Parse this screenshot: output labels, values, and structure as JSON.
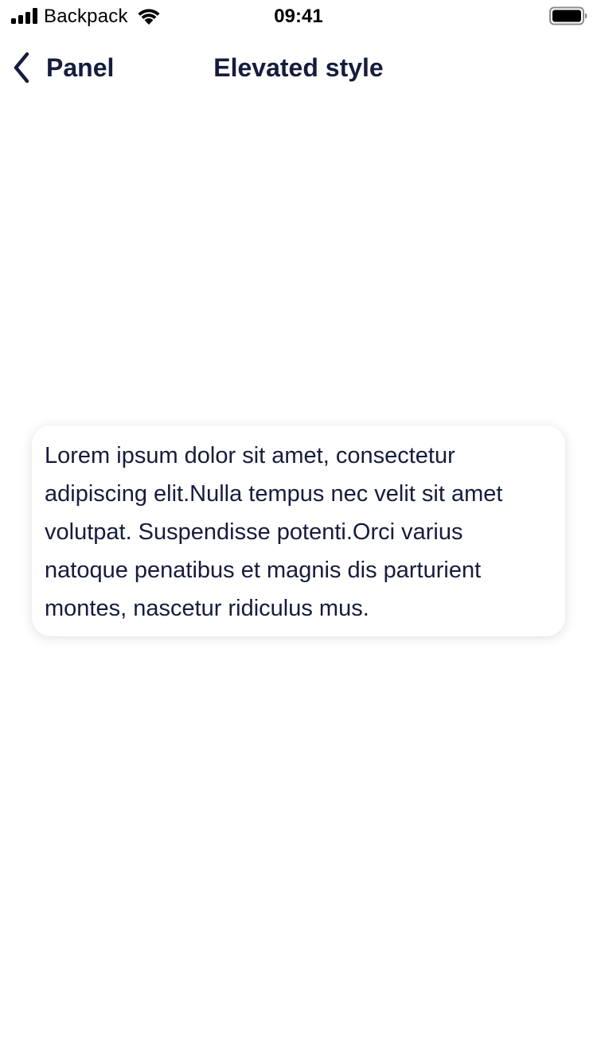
{
  "status_bar": {
    "carrier": "Backpack",
    "time": "09:41",
    "icons": [
      "signal-icon",
      "wifi-icon",
      "battery-icon"
    ]
  },
  "nav": {
    "back_label": "Panel",
    "title": "Elevated style",
    "back_icon": "chevron-left-icon"
  },
  "panel": {
    "text": "Lorem ipsum dolor sit amet, consectetur adipiscing elit.Nulla tempus nec velit sit amet volutpat. Suspendisse potenti.Orci varius natoque penatibus et magnis dis parturient montes, nascetur ridiculus mus."
  },
  "colors": {
    "text_primary": "#161c3c",
    "background": "#ffffff"
  }
}
